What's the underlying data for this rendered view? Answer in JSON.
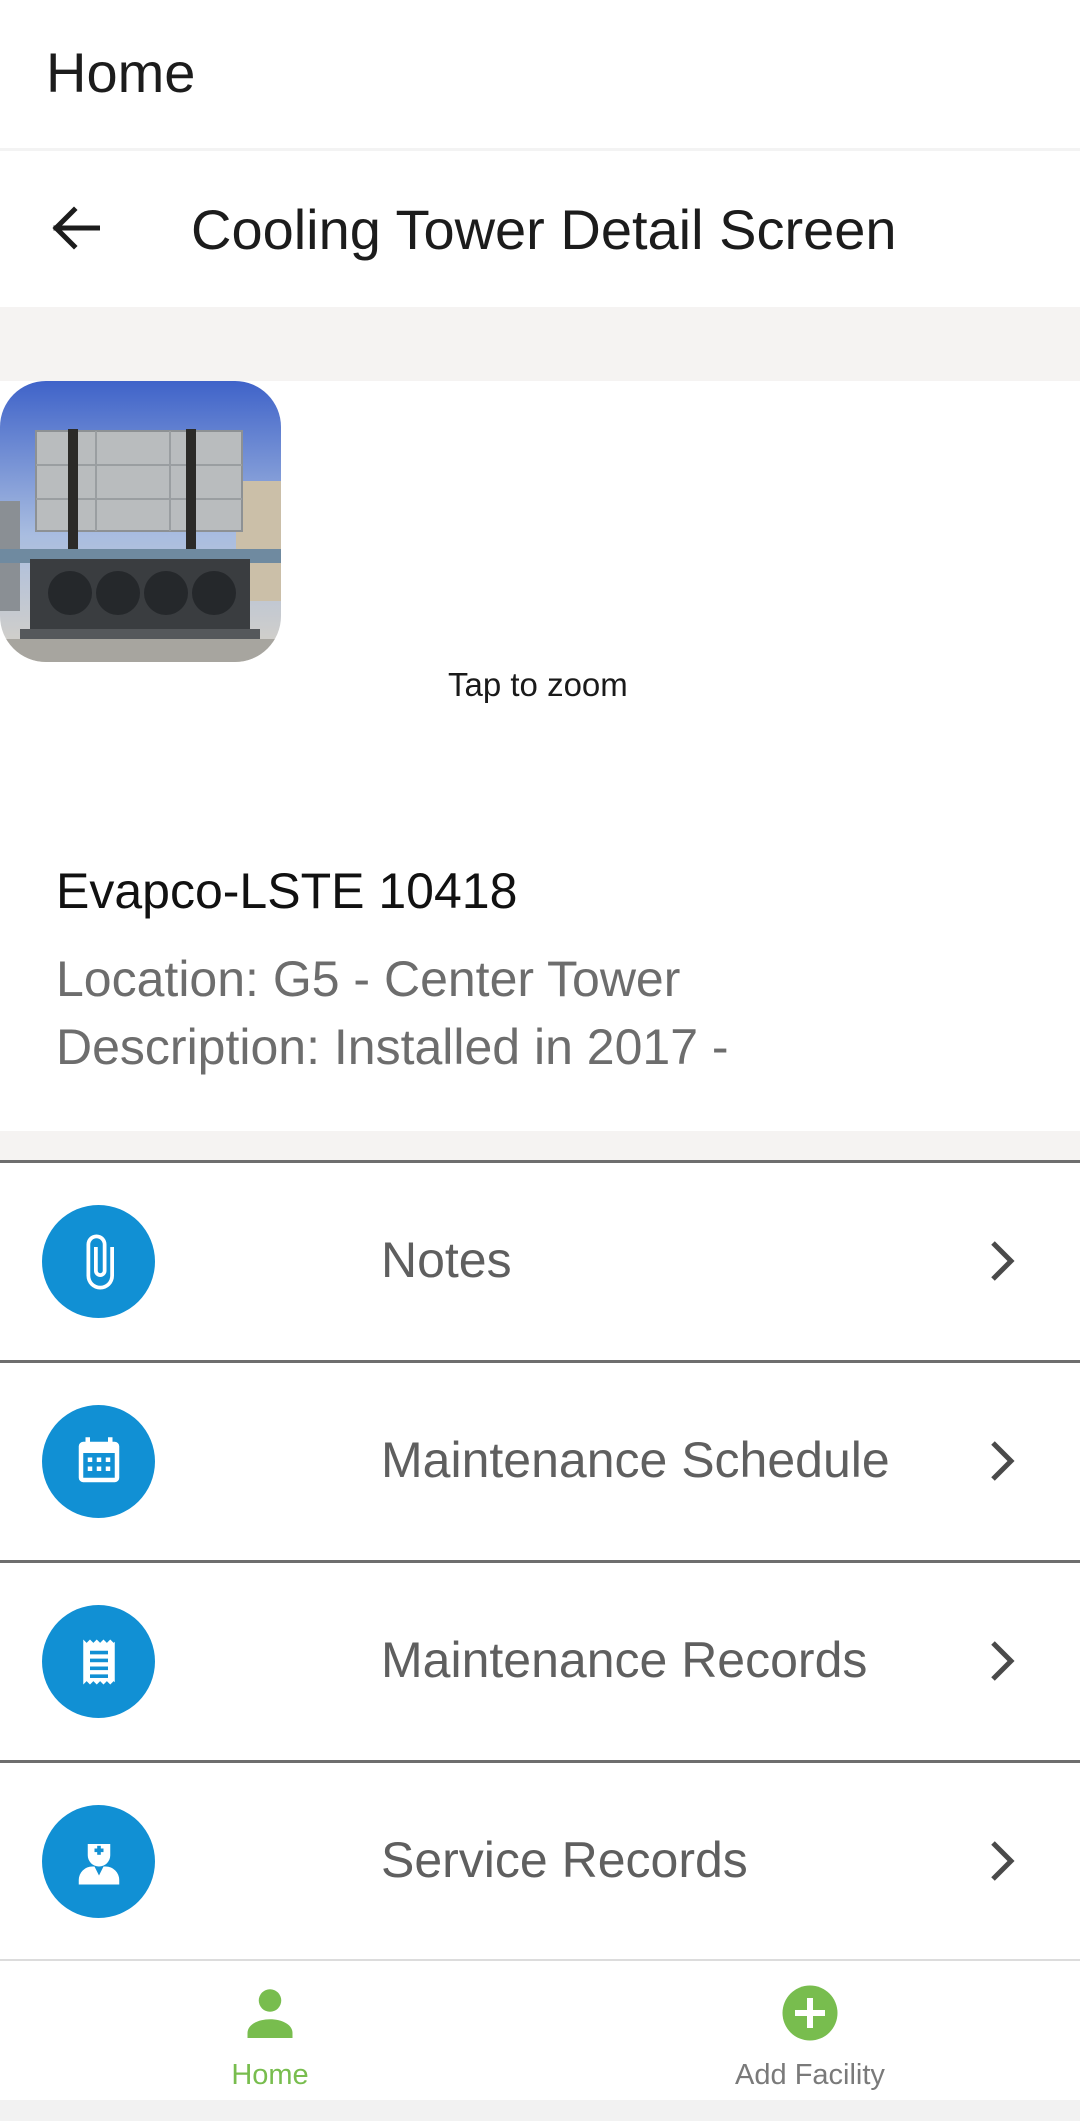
{
  "app_bar": {
    "title": "Home"
  },
  "header": {
    "title": "Cooling Tower Detail Screen",
    "back_icon": "arrow-back-icon"
  },
  "photo": {
    "hint": "Tap to zoom"
  },
  "unit": {
    "name": "Evapco-LSTE 10418",
    "location": "Location: G5 - Center Tower",
    "description": "Description: Installed in 2017 -"
  },
  "menu": [
    {
      "label": "Notes",
      "icon": "paperclip-icon"
    },
    {
      "label": "Maintenance Schedule",
      "icon": "calendar-icon"
    },
    {
      "label": "Maintenance Records",
      "icon": "receipt-icon"
    },
    {
      "label": "Service Records",
      "icon": "technician-icon"
    }
  ],
  "bottom_nav": {
    "tabs": [
      {
        "label": "Home",
        "icon": "person-icon",
        "active": true
      },
      {
        "label": "Add Facility",
        "icon": "add-circle-icon",
        "active": false
      }
    ]
  },
  "colors": {
    "accent": "#1190d4",
    "nav_active": "#78bd4e",
    "nav_inactive": "#7a7a7a",
    "band": "#f5f3f2"
  }
}
